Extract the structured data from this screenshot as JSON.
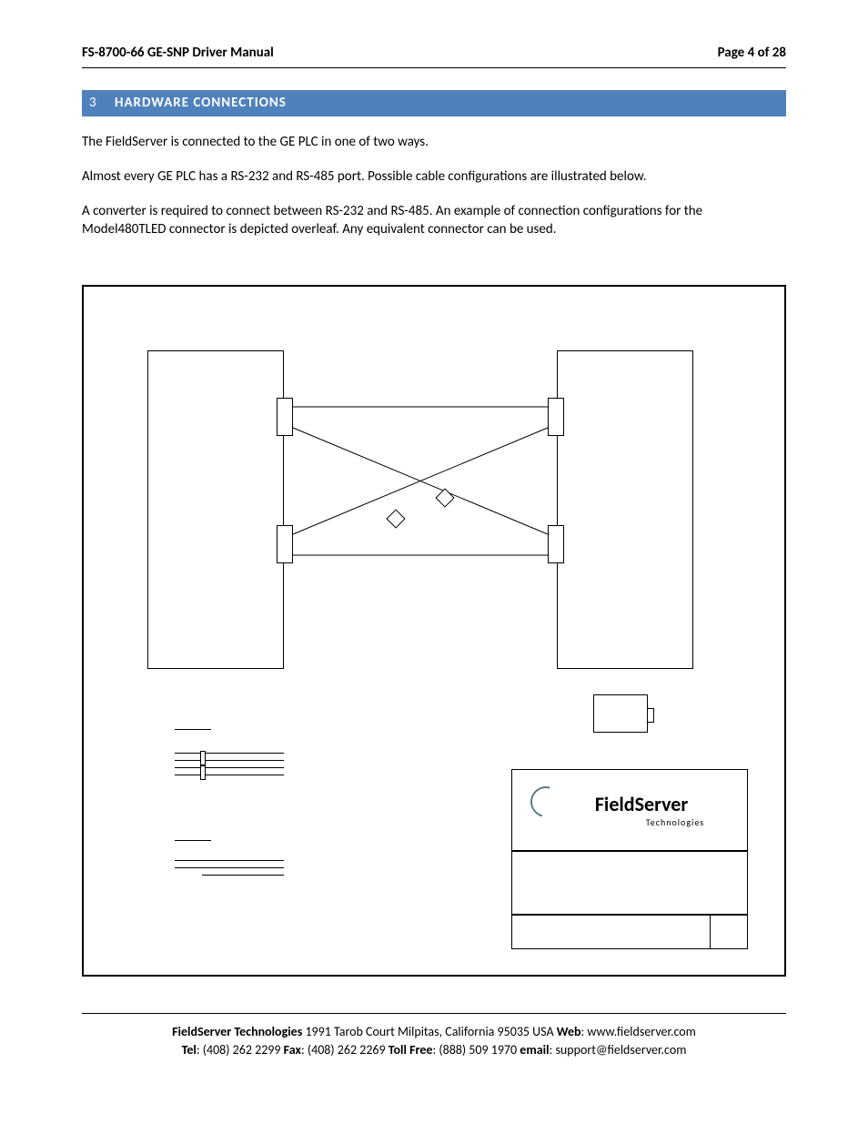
{
  "header": {
    "doc_title": "FS-8700-66 GE-SNP Driver Manual",
    "page_label": "Page 4 of 28"
  },
  "section": {
    "number": "3",
    "title": "HARDWARE CONNECTIONS"
  },
  "paragraphs": {
    "p1": "The FieldServer is connected to the GE PLC in one of two ways.",
    "p2": "Almost every GE PLC has a RS-232 and RS-485 port.  Possible cable configurations are illustrated below.",
    "p3": "A converter is required to connect between RS-232 and RS-485.  An example of connection configurations for the Model480TLED connector is depicted overleaf.  Any equivalent connector can be used."
  },
  "logo": {
    "name": "FieldServer",
    "sub": "Technologies"
  },
  "footer": {
    "line1_company": "FieldServer Technologies",
    "line1_addr": " 1991 Tarob Court Milpitas, California 95035 USA   ",
    "line1_web_label": "Web",
    "line1_web": ": www.fieldserver.com",
    "line2_tel_label": "Tel",
    "line2_tel": ": (408) 262 2299   ",
    "line2_fax_label": "Fax",
    "line2_fax": ": (408) 262 2269   ",
    "line2_toll_label": "Toll Free",
    "line2_toll": ": (888) 509 1970   ",
    "line2_email_label": "email",
    "line2_email": ": support@fieldserver.com"
  }
}
